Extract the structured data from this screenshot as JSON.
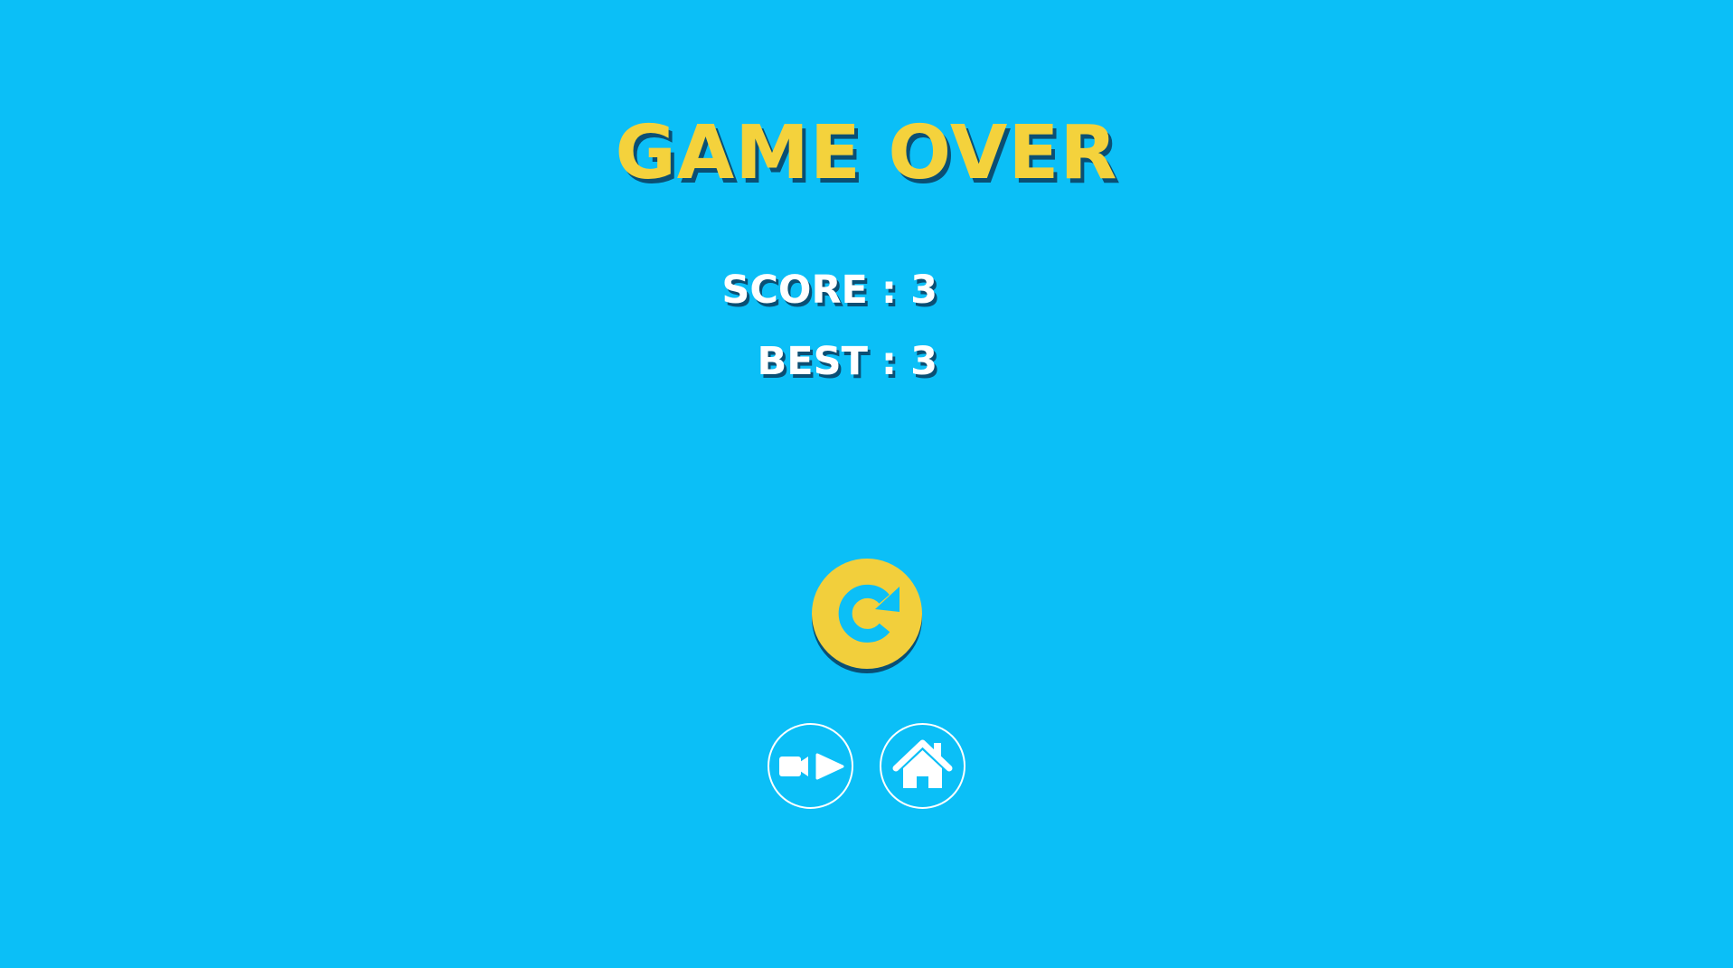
{
  "screen": {
    "title": "GAME OVER",
    "score_label": "SCORE",
    "score_value": "3",
    "best_label": "BEST",
    "best_value": "3",
    "separator": " : "
  },
  "buttons": {
    "replay": {
      "icon": "replay-icon"
    },
    "video": {
      "icon": "video-play-icon"
    },
    "home": {
      "icon": "home-icon"
    }
  },
  "colors": {
    "background": "#0bbff7",
    "title": "#f4d23c",
    "stat_text": "#ffffff",
    "text_shadow": "#0a4f74",
    "replay_button": "#f2cf3c",
    "icon_outline": "#ffffff"
  }
}
